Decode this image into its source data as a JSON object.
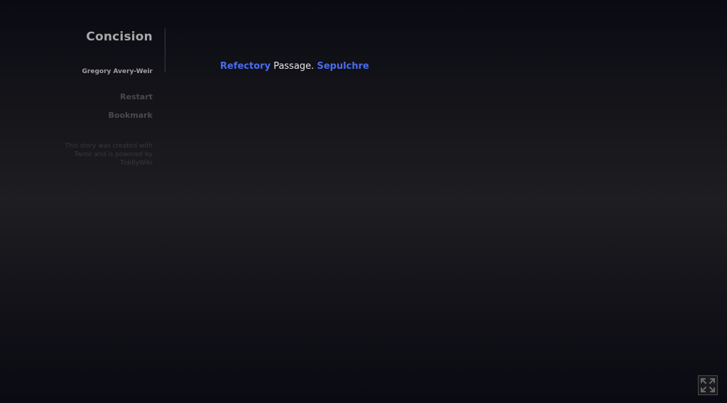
{
  "sidebar": {
    "title": "Concision",
    "author": "Gregory Avery-Weir",
    "menu": {
      "restart_label": "Restart",
      "bookmark_label": "Bookmark"
    },
    "credits": "This story was created with Twine and is powered by TiddlyWiki"
  },
  "passage": {
    "link_left": "Refectory",
    "text": "Passage.",
    "link_right": "Sepulchre"
  },
  "colors": {
    "link": "#4a6cf0",
    "text": "#e8e8e8",
    "title": "#a8a8a8"
  },
  "icons": {
    "fullscreen": "expand-arrows-icon"
  }
}
